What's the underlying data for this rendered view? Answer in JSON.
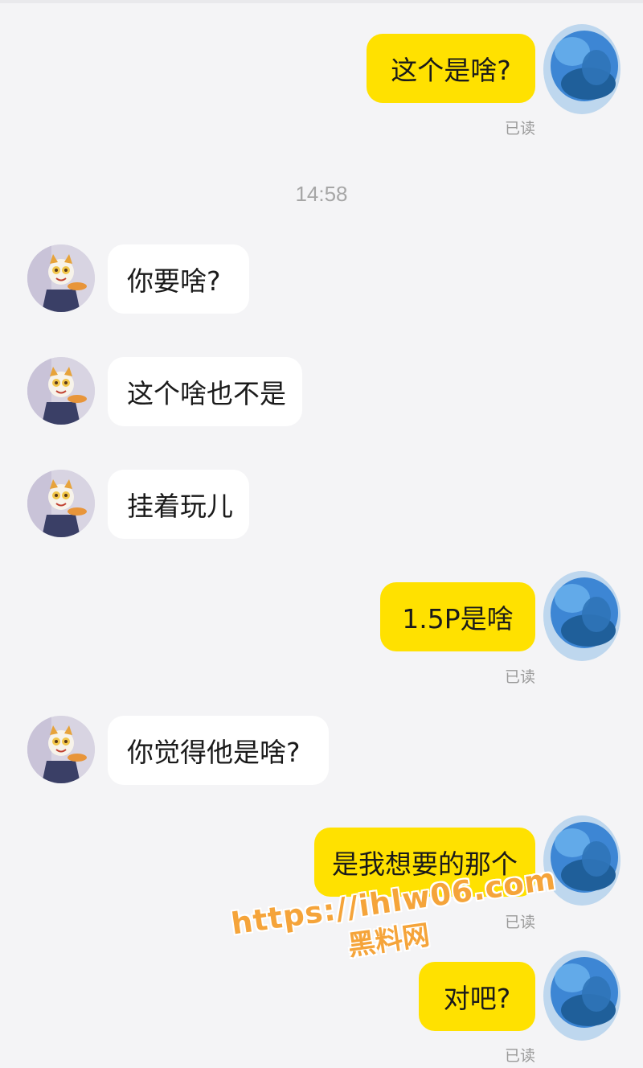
{
  "messages": [
    {
      "side": "out",
      "text": "这个是啥?",
      "status": "已读"
    },
    {
      "side": "time",
      "text": "14:58"
    },
    {
      "side": "in",
      "text": "你要啥?"
    },
    {
      "side": "in",
      "text": "这个啥也不是"
    },
    {
      "side": "in",
      "text": "挂着玩儿"
    },
    {
      "side": "out",
      "text": "1.5P是啥",
      "status": "已读"
    },
    {
      "side": "in",
      "text": "你觉得他是啥?"
    },
    {
      "side": "out",
      "text": "是我想要的那个",
      "status": "已读"
    },
    {
      "side": "out",
      "text": "对吧?",
      "status": "已读"
    }
  ],
  "watermark": {
    "url": "https://ihlw06.com",
    "name": "黑料网",
    "color": "#f5a43a"
  },
  "colors": {
    "out_bubble": "#ffe100",
    "in_bubble": "#ffffff",
    "background": "#f4f4f6"
  },
  "icons": {
    "contact_avatar": "cartoon-cat-avatar-icon",
    "my_avatar": "blurred-blue-avatar-icon"
  }
}
